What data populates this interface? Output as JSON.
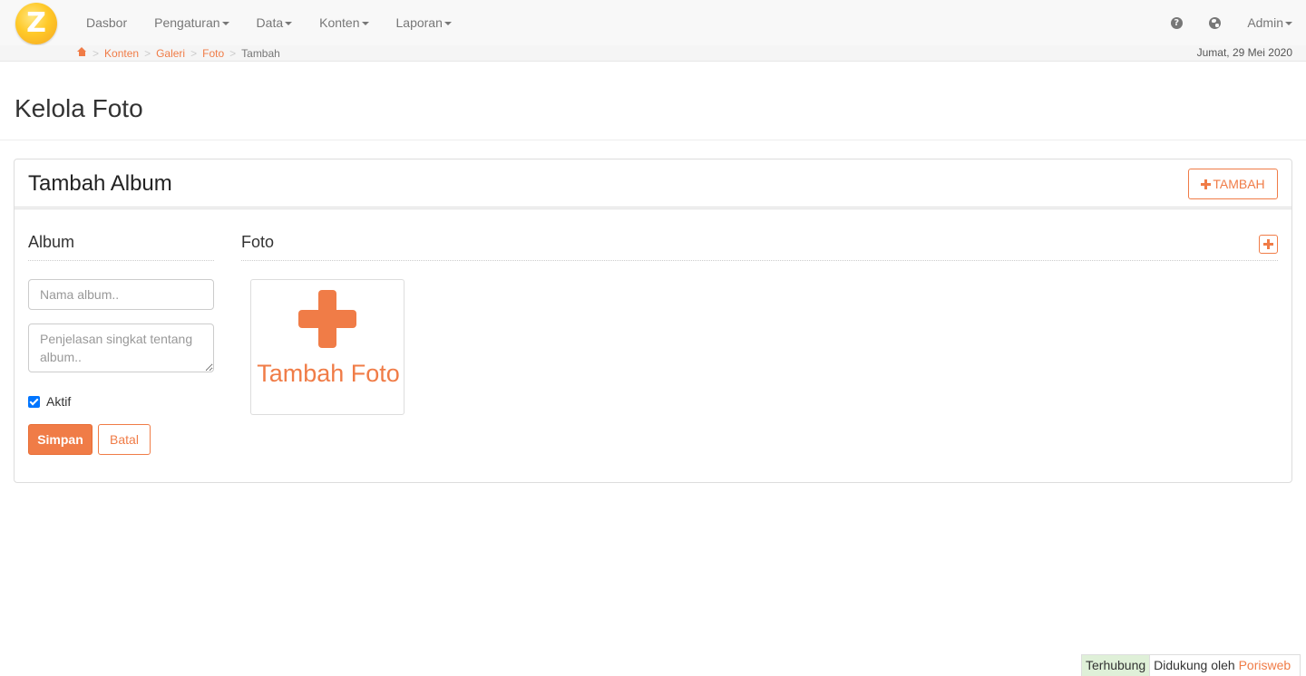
{
  "navbar": {
    "logo_letter": "Z",
    "menu": [
      {
        "label": "Dasbor",
        "has_caret": false
      },
      {
        "label": "Pengaturan",
        "has_caret": true
      },
      {
        "label": "Data",
        "has_caret": true
      },
      {
        "label": "Konten",
        "has_caret": true
      },
      {
        "label": "Laporan",
        "has_caret": true
      }
    ],
    "help_icon": "question-circle-icon",
    "globe_icon": "globe-icon",
    "user_label": "Admin"
  },
  "breadcrumb": {
    "home_icon": "home-icon",
    "items": [
      "Konten",
      "Galeri",
      "Foto"
    ],
    "active": "Tambah",
    "separator": ">"
  },
  "date": "Jumat, 29 Mei 2020",
  "page": {
    "title": "Kelola Foto"
  },
  "panel": {
    "title": "Tambah Album",
    "add_button_label": "TAMBAH"
  },
  "album": {
    "section_title": "Album",
    "name_placeholder": "Nama album..",
    "description_placeholder": "Penjelasan singkat tentang album..",
    "active_label": "Aktif",
    "active_checked": true,
    "save_label": "Simpan",
    "cancel_label": "Batal"
  },
  "photo": {
    "section_title": "Foto",
    "add_photo_label": "Tambah Foto"
  },
  "footer": {
    "status": "Terhubung",
    "supported_by": "Didukung oleh",
    "supported_link": "Porisweb"
  },
  "colors": {
    "accent": "#f07c47",
    "navbar_bg": "#f8f8f8",
    "status_bg": "#dff0d8",
    "checkbox": "#0075ff"
  }
}
